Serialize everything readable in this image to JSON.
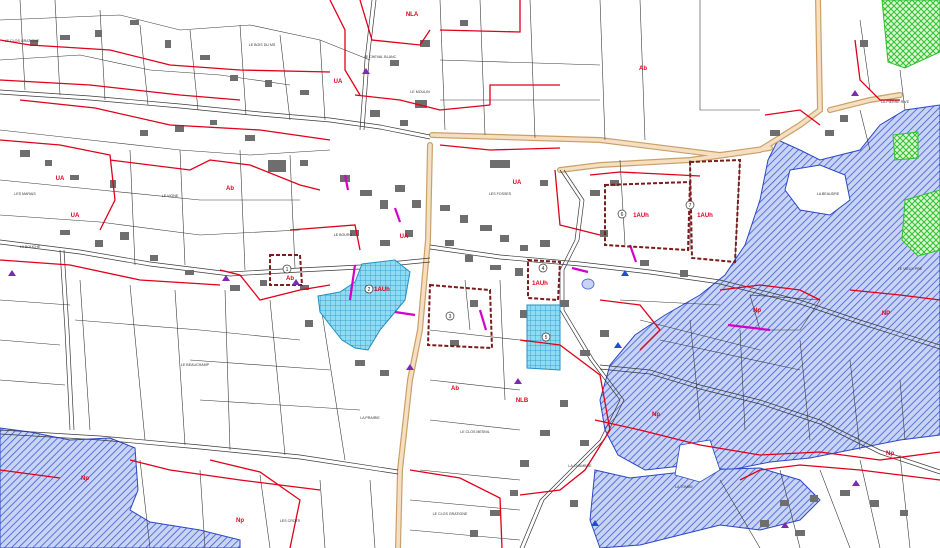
{
  "colors": {
    "zone_boundary": "#e0001a",
    "parcel_line": "#3a3a3a",
    "road_fill": "#f5dfc0",
    "road_edge": "#c9a06a",
    "flood_hatch": "#3b5bd6",
    "flood_fill": "#c9d4f5",
    "wooded_hatch": "#2fbf2f",
    "wooded_fill": "#c8f2c0",
    "project_fill": "#7fd3ee",
    "project_grid": "#1f8fc4",
    "building": "#6e6e6e",
    "oap_outline": "#7a1c1c",
    "protected_hedge": "#d400c8",
    "zone_label": "#e0001a"
  },
  "zone_labels": [
    {
      "id": "z1",
      "text": "NLA"
    },
    {
      "id": "z2",
      "text": "Ab"
    },
    {
      "id": "z3",
      "text": "UA"
    },
    {
      "id": "z4",
      "text": "UA"
    },
    {
      "id": "z5",
      "text": "Ab"
    },
    {
      "id": "z6",
      "text": "UA"
    },
    {
      "id": "z7",
      "text": "UA"
    },
    {
      "id": "z8",
      "text": "Ab"
    },
    {
      "id": "z9",
      "text": "1AUh"
    },
    {
      "id": "z10",
      "text": "1AUh"
    },
    {
      "id": "z11",
      "text": "1AUh"
    },
    {
      "id": "z12",
      "text": "1AUh"
    },
    {
      "id": "z13",
      "text": "Ab"
    },
    {
      "id": "z14",
      "text": "NLB"
    },
    {
      "id": "z15",
      "text": "Np"
    },
    {
      "id": "z16",
      "text": "NP"
    },
    {
      "id": "z17",
      "text": "Np"
    },
    {
      "id": "z18",
      "text": "Np"
    },
    {
      "id": "z19",
      "text": "Np"
    },
    {
      "id": "z20",
      "text": "UA"
    },
    {
      "id": "z21",
      "text": "Np"
    }
  ],
  "place_names": [
    {
      "id": "p1",
      "text": "LE CLOS GRATIGNE"
    },
    {
      "id": "p2",
      "text": "LE BOIS DU MS"
    },
    {
      "id": "p3",
      "text": "LE CHEVAL BLANC"
    },
    {
      "id": "p4",
      "text": "LE VIGNE"
    },
    {
      "id": "p5",
      "text": "LE BOURG"
    },
    {
      "id": "p6",
      "text": "LES FOSSES"
    },
    {
      "id": "p7",
      "text": "LE MOULIN"
    },
    {
      "id": "p8",
      "text": "LA PRAIRIE"
    },
    {
      "id": "p9",
      "text": "LE BEAUCHAMP"
    },
    {
      "id": "p10",
      "text": "LA BEAUDRE"
    },
    {
      "id": "p11",
      "text": "LA PIERRE RIVE"
    },
    {
      "id": "p12",
      "text": "LE CLOS MESNIL"
    },
    {
      "id": "p13",
      "text": "LE CLOS GRATIGNE"
    },
    {
      "id": "p14",
      "text": "LA CHAMBRE"
    },
    {
      "id": "p15",
      "text": "LES CROTS"
    },
    {
      "id": "p16",
      "text": "LA TOMBE"
    },
    {
      "id": "p17",
      "text": "LE VIEUX PRE"
    },
    {
      "id": "p18",
      "text": "LES MARAIS"
    },
    {
      "id": "p19",
      "text": "LA BOUCHE"
    }
  ],
  "oap_numbers": [
    {
      "id": "n1",
      "text": "1"
    },
    {
      "id": "n2",
      "text": "2"
    },
    {
      "id": "n3",
      "text": "3"
    },
    {
      "id": "n4",
      "text": "4"
    },
    {
      "id": "n5",
      "text": "5"
    },
    {
      "id": "n6",
      "text": "6"
    },
    {
      "id": "n7",
      "text": "7"
    }
  ]
}
